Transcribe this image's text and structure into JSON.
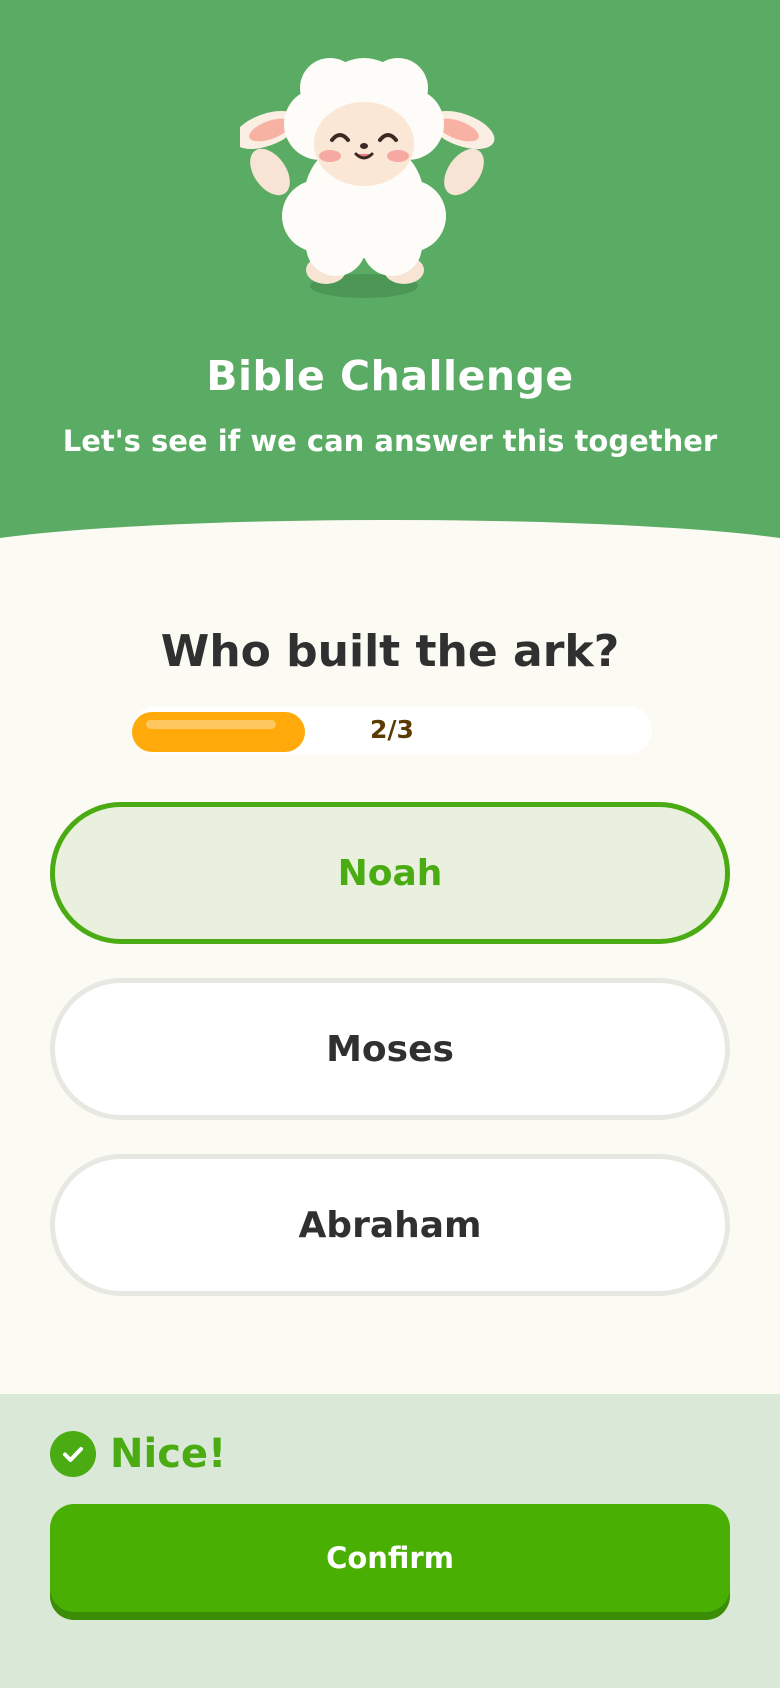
{
  "header": {
    "title": "Bible Challenge",
    "subtitle": "Let's see if we can answer this together",
    "mascot": "lamb-mascot-icon"
  },
  "quiz": {
    "question": "Who built the ark?",
    "progress": {
      "text": "2/3",
      "current": 2,
      "total": 3
    },
    "options": [
      {
        "label": "Noah",
        "selected": true
      },
      {
        "label": "Moses",
        "selected": false
      },
      {
        "label": "Abraham",
        "selected": false
      }
    ]
  },
  "feedback": {
    "icon": "check-circle-icon",
    "message": "Nice!",
    "confirm_label": "Confirm"
  },
  "colors": {
    "header_green": "#5aab64",
    "accent_green": "#4aab12",
    "progress_orange": "#ffa90a",
    "background": "#fbfaf3",
    "feedback_bg": "#d9e8d7"
  }
}
